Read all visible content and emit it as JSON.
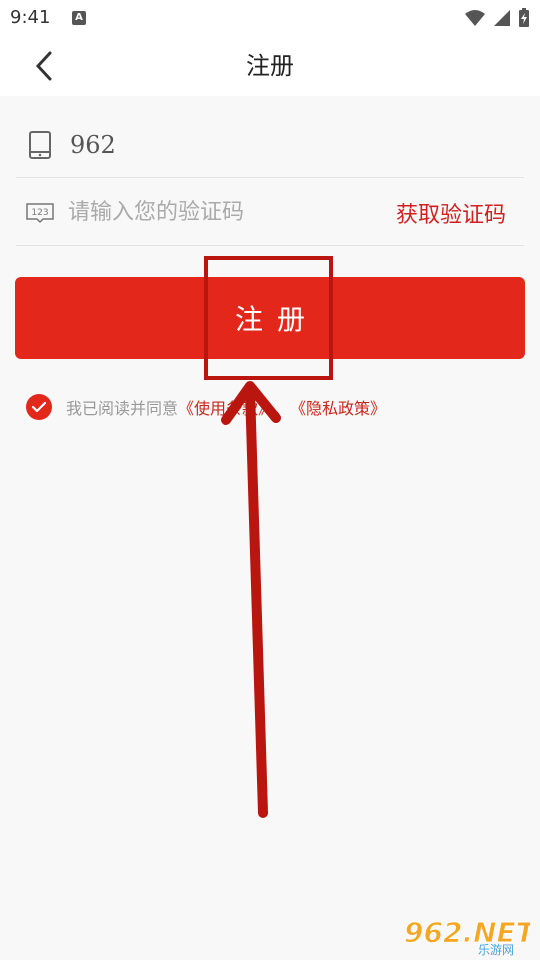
{
  "status_bar": {
    "time": "9:41",
    "indicator": "A"
  },
  "header": {
    "title": "注册",
    "back_icon": "chevron-left-icon"
  },
  "form": {
    "phone_value": "962",
    "code_placeholder": "请输入您的验证码",
    "get_code_label": "获取验证码",
    "register_label": "注册"
  },
  "agreement": {
    "prefix": "我已阅读并同意",
    "terms_link": "《使用条款》",
    "separator": "、",
    "privacy_link": "《隐私政策》",
    "checked": true
  },
  "watermark": {
    "logo": "962.NET",
    "sub": "乐游网"
  },
  "colors": {
    "accent": "#e3271b",
    "link": "#c8281c",
    "annotation": "#b8160f"
  }
}
